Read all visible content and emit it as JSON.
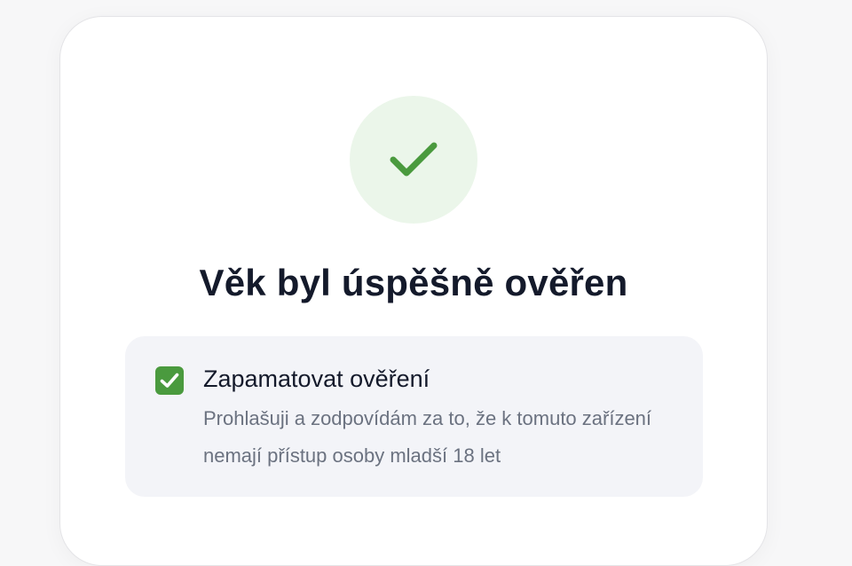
{
  "verification": {
    "title": "Věk byl úspěšně ověřen",
    "status_icon": "checkmark-icon",
    "status_color": "#4a9a3e",
    "status_bg": "#ebf6ea"
  },
  "remember": {
    "checked": true,
    "label": "Zapamatovat ověření",
    "description": "Prohlašuji a zodpovídám za to, že k tomuto zařízení nemají přístup osoby mladší 18 let"
  }
}
